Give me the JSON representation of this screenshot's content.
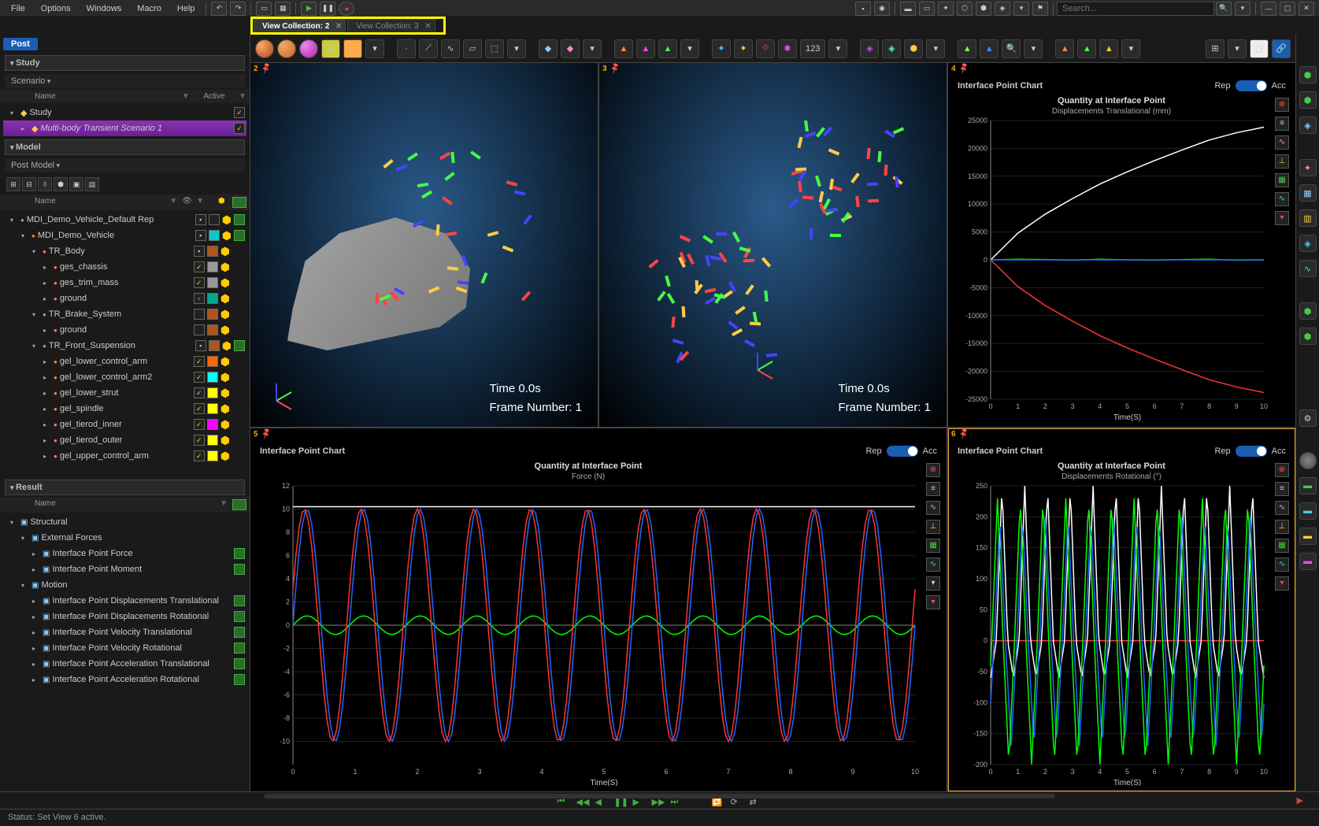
{
  "menubar": {
    "items": [
      "File",
      "Options",
      "Windows",
      "Macro",
      "Help"
    ],
    "search_placeholder": "Search..."
  },
  "tabs": [
    {
      "label": "View Collection: 2",
      "active": true
    },
    {
      "label": "View Collection: 3",
      "active": false
    }
  ],
  "post_badge": "Post",
  "sections": {
    "study": "Study",
    "model": "Model",
    "result": "Result"
  },
  "study": {
    "dd": "Scenario",
    "head_name": "Name",
    "head_active": "Active",
    "rows": [
      {
        "label": "Study",
        "indent": 0,
        "exp": "▾",
        "sel": false,
        "check": true
      },
      {
        "label": "Multi-body Transient Scenario 1",
        "indent": 1,
        "exp": "▸",
        "sel": true,
        "italic": true,
        "check": true
      }
    ]
  },
  "model": {
    "dd": "Post Model",
    "head_name": "Name",
    "rows": [
      {
        "label": "MDI_Demo_Vehicle_Default Rep",
        "indent": 0,
        "exp": "▾",
        "chk": "box",
        "swatch": "#222",
        "hex": true,
        "bar": true
      },
      {
        "label": "MDI_Demo_Vehicle",
        "indent": 1,
        "exp": "▾",
        "chk": "box",
        "swatch": "#0cc",
        "hex": true,
        "bar": true
      },
      {
        "label": "TR_Body",
        "indent": 2,
        "exp": "▾",
        "chk": "box",
        "swatch": "#a52",
        "hex": true
      },
      {
        "label": "ges_chassis",
        "indent": 3,
        "exp": "▸",
        "chk": "tick",
        "swatch": "#999",
        "hex": true
      },
      {
        "label": "ges_trim_mass",
        "indent": 3,
        "exp": "▸",
        "chk": "tick",
        "swatch": "#999",
        "hex": true
      },
      {
        "label": "ground",
        "indent": 3,
        "exp": "▸",
        "chk": "yel",
        "swatch": "#0a8",
        "hex": true
      },
      {
        "label": "TR_Brake_System",
        "indent": 2,
        "exp": "▾",
        "chk": "",
        "swatch": "#a52",
        "hex": true
      },
      {
        "label": "ground",
        "indent": 3,
        "exp": "▸",
        "chk": "",
        "swatch": "#a52",
        "hex": true
      },
      {
        "label": "TR_Front_Suspension",
        "indent": 2,
        "exp": "▾",
        "chk": "box",
        "swatch": "#a52",
        "hex": true,
        "bar": true
      },
      {
        "label": "gel_lower_control_arm",
        "indent": 3,
        "exp": "▸",
        "chk": "tick",
        "swatch": "#f60",
        "hex": true
      },
      {
        "label": "gel_lower_control_arm2",
        "indent": 3,
        "exp": "▸",
        "chk": "tick",
        "swatch": "#0ff",
        "hex": true
      },
      {
        "label": "gel_lower_strut",
        "indent": 3,
        "exp": "▸",
        "chk": "tick",
        "swatch": "#ff0",
        "hex": true
      },
      {
        "label": "gel_spindle",
        "indent": 3,
        "exp": "▸",
        "chk": "tick",
        "swatch": "#ff0",
        "hex": true
      },
      {
        "label": "gel_tierod_inner",
        "indent": 3,
        "exp": "▸",
        "chk": "tick",
        "swatch": "#f0f",
        "hex": true
      },
      {
        "label": "gel_tierod_outer",
        "indent": 3,
        "exp": "▸",
        "chk": "tick",
        "swatch": "#ff0",
        "hex": true
      },
      {
        "label": "gel_upper_control_arm",
        "indent": 3,
        "exp": "▸",
        "chk": "tick",
        "swatch": "#ff0",
        "hex": true
      }
    ]
  },
  "result": {
    "head_name": "Name",
    "rows": [
      {
        "label": "Structural",
        "indent": 0,
        "exp": "▾",
        "bar": false
      },
      {
        "label": "External Forces",
        "indent": 1,
        "exp": "▾",
        "bar": false
      },
      {
        "label": "Interface Point Force",
        "indent": 2,
        "exp": "▸",
        "bar": true
      },
      {
        "label": "Interface Point Moment",
        "indent": 2,
        "exp": "▸",
        "bar": true
      },
      {
        "label": "Motion",
        "indent": 1,
        "exp": "▾",
        "bar": false
      },
      {
        "label": "Interface Point Displacements Translational",
        "indent": 2,
        "exp": "▸",
        "bar": true
      },
      {
        "label": "Interface Point Displacements Rotational",
        "indent": 2,
        "exp": "▸",
        "bar": true
      },
      {
        "label": "Interface Point Velocity Translational",
        "indent": 2,
        "exp": "▸",
        "bar": true
      },
      {
        "label": "Interface Point Velocity Rotational",
        "indent": 2,
        "exp": "▸",
        "bar": true
      },
      {
        "label": "Interface Point Acceleration Translational",
        "indent": 2,
        "exp": "▸",
        "bar": true
      },
      {
        "label": "Interface Point Acceleration Rotational",
        "indent": 2,
        "exp": "▸",
        "bar": true
      }
    ]
  },
  "viewport3d": {
    "time": "Time  0.0s",
    "frame": "Frame  Number:  1"
  },
  "charts": {
    "header": "Interface Point Chart",
    "rep": "Rep",
    "acc": "Acc"
  },
  "chart_data": [
    {
      "pane": 4,
      "type": "line",
      "title": "Quantity at Interface Point",
      "subtitle": "Displacements Translational (mm)",
      "xlabel": "Time(S)",
      "x": [
        0,
        1,
        2,
        3,
        4,
        5,
        6,
        7,
        8,
        9,
        10
      ],
      "ylim": [
        -25000,
        25000
      ],
      "yticks": [
        -25000,
        -20000,
        -15000,
        -10000,
        -5000,
        0,
        5000,
        10000,
        15000,
        20000,
        25000
      ],
      "series": [
        {
          "name": "white",
          "color": "#fff",
          "values": [
            0,
            4800,
            8200,
            11000,
            13600,
            15800,
            17800,
            19700,
            21500,
            22800,
            23800
          ]
        },
        {
          "name": "green",
          "color": "#0f0",
          "values": [
            0,
            100,
            50,
            -50,
            100,
            0,
            -50,
            50,
            100,
            -50,
            0
          ]
        },
        {
          "name": "blue",
          "color": "#26f",
          "values": [
            0,
            0,
            0,
            0,
            0,
            0,
            0,
            0,
            0,
            0,
            0
          ]
        },
        {
          "name": "red",
          "color": "#f33",
          "values": [
            0,
            -4800,
            -8200,
            -11000,
            -13600,
            -15800,
            -17800,
            -19700,
            -21500,
            -22800,
            -23800
          ]
        }
      ]
    },
    {
      "pane": 5,
      "type": "line",
      "title": "Quantity at Interface Point",
      "subtitle": "Force (N)",
      "xlabel": "Time(S)",
      "x_dense": true,
      "xrange": [
        0,
        10
      ],
      "ylim": [
        -12,
        12
      ],
      "yticks": [
        -10,
        -8,
        -6,
        -4,
        -2,
        0,
        2,
        4,
        6,
        8,
        10,
        12
      ],
      "series": [
        {
          "name": "white",
          "color": "#fff",
          "flat": 10.2
        },
        {
          "name": "green",
          "color": "#0f0",
          "amp": 0.8,
          "freq": 11,
          "offset": 0
        },
        {
          "name": "blue",
          "color": "#26f",
          "amp": 10,
          "freq": 11,
          "offset": 0
        },
        {
          "name": "red",
          "color": "#f33",
          "amp": 10,
          "freq": 11,
          "phase": 0.5
        }
      ]
    },
    {
      "pane": 6,
      "type": "line",
      "title": "Quantity at Interface Point",
      "subtitle": "Displacements Rotational (°)",
      "xlabel": "Time(S)",
      "x_dense": true,
      "xrange": [
        0,
        10
      ],
      "ylim": [
        -200,
        250
      ],
      "yticks": [
        -200,
        -150,
        -100,
        -50,
        0,
        50,
        100,
        150,
        200,
        250
      ],
      "series": [
        {
          "name": "red",
          "color": "#f33",
          "flat": 0
        },
        {
          "name": "white",
          "color": "#fff",
          "amp_pos": 250,
          "amp_neg": 60,
          "freq": 12,
          "shape": "tri"
        },
        {
          "name": "blue",
          "color": "#26f",
          "amp_pos": 200,
          "amp_neg": 170,
          "freq": 12,
          "shape": "tri",
          "phase": 0.1
        },
        {
          "name": "green",
          "color": "#0f0",
          "amp_pos": 230,
          "amp_neg": 200,
          "freq": 12,
          "shape": "tri",
          "phase": 0.2
        }
      ]
    }
  ],
  "status": "Status:  Set View 6 active.",
  "toolbar_num": "123"
}
